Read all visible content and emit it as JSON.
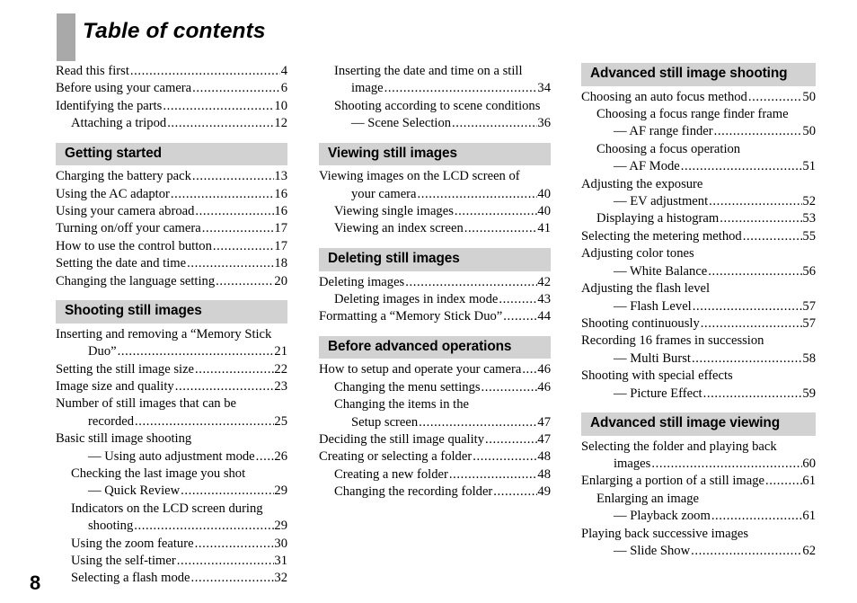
{
  "page": {
    "title": "Table of contents",
    "folio": "8",
    "accent_bar_color": "#a9a9a9",
    "section_header_bg": "#d2d2d2"
  },
  "columns": [
    {
      "id": "column-1",
      "blocks": [
        {
          "type": "entries",
          "items": [
            {
              "label": "Read this first",
              "page": "4",
              "indent": 0
            },
            {
              "label": "Before using your camera",
              "page": "6",
              "indent": 0
            },
            {
              "label": "Identifying the parts",
              "page": "10",
              "indent": 0
            },
            {
              "label": "Attaching a tripod",
              "page": "12",
              "indent": 1
            }
          ]
        },
        {
          "type": "section",
          "heading": "Getting started",
          "items": [
            {
              "label": "Charging the battery pack",
              "page": "13",
              "indent": 0
            },
            {
              "label": "Using the AC adaptor",
              "page": "16",
              "indent": 0
            },
            {
              "label": "Using your camera abroad",
              "page": "16",
              "indent": 0
            },
            {
              "label": "Turning on/off your camera",
              "page": "17",
              "indent": 0
            },
            {
              "label": "How to use the control button",
              "page": "17",
              "indent": 0
            },
            {
              "label": "Setting the date and time",
              "page": "18",
              "indent": 0
            },
            {
              "label": "Changing the language setting",
              "page": "20",
              "indent": 0
            }
          ]
        },
        {
          "type": "section",
          "heading": "Shooting still images",
          "items": [
            {
              "label": "Inserting and removing a “Memory Stick",
              "page": "",
              "indent": 0
            },
            {
              "label": "Duo”",
              "page": "21",
              "indent": 2
            },
            {
              "label": "Setting the still image size",
              "page": "22",
              "indent": 0
            },
            {
              "label": "Image size and quality",
              "page": "23",
              "indent": 0
            },
            {
              "label": "Number of still images that can be",
              "page": "",
              "indent": 0
            },
            {
              "label": "recorded",
              "page": "25",
              "indent": 2
            },
            {
              "label": "Basic still image shooting",
              "page": "",
              "indent": 0
            },
            {
              "label": "— Using auto adjustment mode",
              "page": "26",
              "indent": 2
            },
            {
              "label": "Checking the last image you shot",
              "page": "",
              "indent": 1
            },
            {
              "label": "— Quick Review",
              "page": "29",
              "indent": 2
            },
            {
              "label": "Indicators on the LCD screen during",
              "page": "",
              "indent": 1
            },
            {
              "label": "shooting",
              "page": "29",
              "indent": 2
            },
            {
              "label": "Using the zoom feature",
              "page": "30",
              "indent": 1
            },
            {
              "label": "Using the self-timer",
              "page": "31",
              "indent": 1
            },
            {
              "label": "Selecting a flash mode",
              "page": "32",
              "indent": 1
            }
          ]
        }
      ]
    },
    {
      "id": "column-2",
      "blocks": [
        {
          "type": "entries",
          "items": [
            {
              "label": "Inserting the date and time on a still",
              "page": "",
              "indent": 1
            },
            {
              "label": "image",
              "page": "34",
              "indent": 2
            },
            {
              "label": "Shooting according to scene conditions",
              "page": "",
              "indent": 1
            },
            {
              "label": "— Scene Selection",
              "page": "36",
              "indent": 2
            }
          ]
        },
        {
          "type": "section",
          "heading": "Viewing still images",
          "items": [
            {
              "label": "Viewing images on the LCD screen of",
              "page": "",
              "indent": 0
            },
            {
              "label": "your camera",
              "page": "40",
              "indent": 2
            },
            {
              "label": "Viewing single images",
              "page": "40",
              "indent": 1
            },
            {
              "label": "Viewing an index screen",
              "page": "41",
              "indent": 1
            }
          ]
        },
        {
          "type": "section",
          "heading": "Deleting still images",
          "items": [
            {
              "label": "Deleting images",
              "page": "42",
              "indent": 0
            },
            {
              "label": "Deleting images in index mode",
              "page": "43",
              "indent": 1
            },
            {
              "label": "Formatting a “Memory Stick Duo”",
              "page": "44",
              "indent": 0
            }
          ]
        },
        {
          "type": "section",
          "heading": "Before advanced operations",
          "items": [
            {
              "label": "How to setup and operate your camera",
              "page": "46",
              "indent": 0
            },
            {
              "label": "Changing the menu settings",
              "page": "46",
              "indent": 1
            },
            {
              "label": "Changing the items in the",
              "page": "",
              "indent": 1
            },
            {
              "label": "Setup screen",
              "page": "47",
              "indent": 2
            },
            {
              "label": "Deciding the still image quality",
              "page": "47",
              "indent": 0
            },
            {
              "label": "Creating or selecting a folder",
              "page": "48",
              "indent": 0
            },
            {
              "label": "Creating a new folder",
              "page": "48",
              "indent": 1
            },
            {
              "label": "Changing the recording folder",
              "page": "49",
              "indent": 1
            }
          ]
        }
      ]
    },
    {
      "id": "column-3",
      "blocks": [
        {
          "type": "section",
          "heading": "Advanced still image shooting",
          "first": true,
          "items": [
            {
              "label": "Choosing an auto focus method",
              "page": "50",
              "indent": 0
            },
            {
              "label": "Choosing a focus range finder frame",
              "page": "",
              "indent": 1
            },
            {
              "label": "— AF range finder",
              "page": "50",
              "indent": 2
            },
            {
              "label": "Choosing a focus operation",
              "page": "",
              "indent": 1
            },
            {
              "label": "— AF Mode",
              "page": "51",
              "indent": 2
            },
            {
              "label": "Adjusting the exposure",
              "page": "",
              "indent": 0
            },
            {
              "label": "— EV adjustment",
              "page": "52",
              "indent": 2
            },
            {
              "label": "Displaying a histogram",
              "page": "53",
              "indent": 1
            },
            {
              "label": "Selecting the metering method",
              "page": "55",
              "indent": 0
            },
            {
              "label": "Adjusting color tones",
              "page": "",
              "indent": 0
            },
            {
              "label": "— White Balance",
              "page": "56",
              "indent": 2
            },
            {
              "label": "Adjusting the flash level",
              "page": "",
              "indent": 0
            },
            {
              "label": "— Flash Level",
              "page": "57",
              "indent": 2
            },
            {
              "label": "Shooting continuously",
              "page": "57",
              "indent": 0
            },
            {
              "label": "Recording 16 frames in succession",
              "page": "",
              "indent": 0
            },
            {
              "label": "— Multi Burst",
              "page": "58",
              "indent": 2
            },
            {
              "label": "Shooting with special effects",
              "page": "",
              "indent": 0
            },
            {
              "label": "— Picture Effect",
              "page": "59",
              "indent": 2
            }
          ]
        },
        {
          "type": "section",
          "heading": "Advanced still image viewing",
          "items": [
            {
              "label": "Selecting the folder and playing back",
              "page": "",
              "indent": 0
            },
            {
              "label": "images",
              "page": "60",
              "indent": 2
            },
            {
              "label": "Enlarging a portion of a still image",
              "page": "61",
              "indent": 0
            },
            {
              "label": "Enlarging an image",
              "page": "",
              "indent": 1
            },
            {
              "label": "— Playback zoom",
              "page": "61",
              "indent": 2
            },
            {
              "label": "Playing back successive images",
              "page": "",
              "indent": 0
            },
            {
              "label": "— Slide Show",
              "page": "62",
              "indent": 2
            }
          ]
        }
      ]
    }
  ]
}
